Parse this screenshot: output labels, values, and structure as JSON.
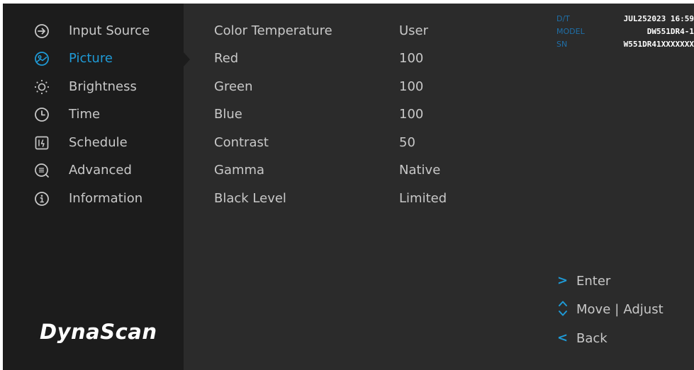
{
  "colors": {
    "accent": "#1f9ad6",
    "sidebar_bg": "#1c1c1c",
    "panel_bg": "#2b2b2b",
    "text": "#c8c8c8",
    "info_label": "#1f6fa8"
  },
  "sidebar": {
    "items": [
      {
        "label": "Input Source",
        "icon": "input-source-icon",
        "active": false
      },
      {
        "label": "Picture",
        "icon": "picture-icon",
        "active": true
      },
      {
        "label": "Brightness",
        "icon": "brightness-icon",
        "active": false
      },
      {
        "label": "Time",
        "icon": "clock-icon",
        "active": false
      },
      {
        "label": "Schedule",
        "icon": "schedule-icon",
        "active": false
      },
      {
        "label": "Advanced",
        "icon": "advanced-icon",
        "active": false
      },
      {
        "label": "Information",
        "icon": "info-icon",
        "active": false
      }
    ],
    "logo": "DynaScan"
  },
  "settings": [
    {
      "label": "Color Temperature",
      "value": "User"
    },
    {
      "label": "Red",
      "value": "100"
    },
    {
      "label": "Green",
      "value": "100"
    },
    {
      "label": "Blue",
      "value": "100"
    },
    {
      "label": "Contrast",
      "value": "50"
    },
    {
      "label": "Gamma",
      "value": "Native"
    },
    {
      "label": "Black Level",
      "value": "Limited"
    }
  ],
  "info": {
    "dt_label": "D/T",
    "dt_value": "JUL252023 16:59",
    "model_label": "MODEL",
    "model_value": "DW551DR4-1",
    "sn_label": "SN",
    "sn_value": "W551DR41XXXXXXX"
  },
  "nav": {
    "enter_symbol": ">",
    "enter_label": "Enter",
    "move_label": "Move",
    "separator": "|",
    "adjust_label": "Adjust",
    "back_symbol": "<",
    "back_label": "Back"
  }
}
